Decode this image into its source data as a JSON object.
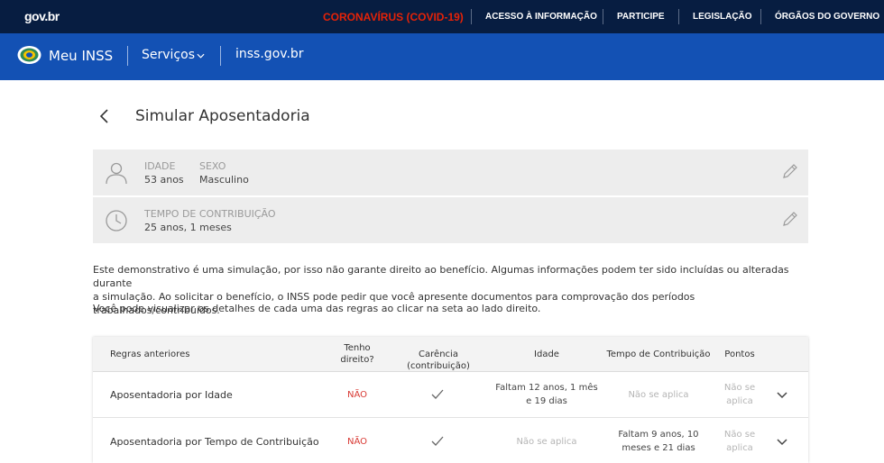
{
  "govbar": {
    "logo": "gov.br",
    "covid": "CORONAVÍRUS (COVID-19)",
    "links": [
      "ACESSO À INFORMAÇÃO",
      "PARTICIPE",
      "LEGISLAÇÃO",
      "ÓRGÃOS DO GOVERNO"
    ]
  },
  "appbar": {
    "title": "Meu INSS",
    "servicos": "Serviços",
    "domain": "inss.gov.br"
  },
  "page": {
    "title": "Simular Aposentadoria"
  },
  "profile": {
    "idade_label": "IDADE",
    "idade_value": "53 anos",
    "sexo_label": "SEXO",
    "sexo_value": "Masculino",
    "tempo_label": "TEMPO DE CONTRIBUIÇÃO",
    "tempo_value": "25 anos, 1 meses"
  },
  "info": {
    "line1": "Este demonstrativo é uma simulação, por isso não garante direito ao benefício. Algumas informações podem ter sido incluídas ou alteradas durante",
    "line2": "a simulação. Ao solicitar o benefício, o INSS pode pedir que você apresente documentos para comprovação dos períodos trabalhados/contribuídos.",
    "line3": "Você pode visualizar os detalhes de cada uma das regras ao clicar na seta ao lado direito."
  },
  "table": {
    "headers": {
      "regras": "Regras anteriores",
      "tenho1": "Tenho",
      "tenho2": "direito?",
      "carencia": "Carência (contribuição)",
      "idade": "Idade",
      "tempo": "Tempo de Contribuição",
      "pontos": "Pontos"
    },
    "rows": [
      {
        "name": "Aposentadoria por Idade",
        "direito": "NÃO",
        "idade1": "Faltam 12 anos, 1 mês",
        "idade2": "e 19 dias",
        "tempo1": "Não se aplica",
        "pontos1": "Não se",
        "pontos2": "aplica"
      },
      {
        "name": "Aposentadoria por Tempo de Contribuição",
        "direito": "NÃO",
        "idade1": "Não se aplica",
        "tempo1": "Faltam 9 anos, 10",
        "tempo2": "meses e 21 dias",
        "pontos1": "Não se",
        "pontos2": "aplica"
      }
    ]
  },
  "colors": {
    "govbar": "#071d41",
    "appbar": "#1351b4",
    "covid": "#e52207",
    "negative": "#d83933"
  }
}
